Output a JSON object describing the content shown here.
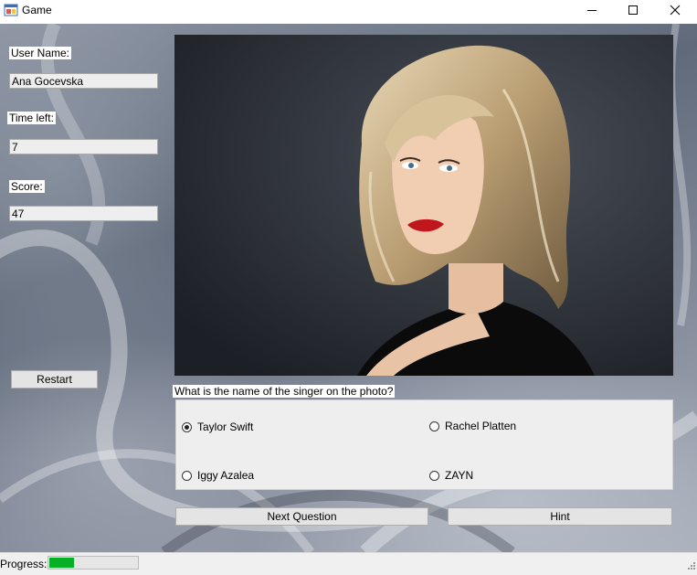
{
  "window": {
    "title": "Game"
  },
  "sidebar": {
    "username_label": "User Name:",
    "username_value": "Ana Gocevska",
    "time_label": "Time left:",
    "time_value": "7",
    "score_label": "Score:",
    "score_value": "47",
    "restart_label": "Restart"
  },
  "quiz": {
    "question": "What is the name of the singer on the photo?",
    "options": [
      {
        "label": "Taylor Swift",
        "selected": true
      },
      {
        "label": "Rachel Platten",
        "selected": false
      },
      {
        "label": "Iggy Azalea",
        "selected": false
      },
      {
        "label": "ZAYN",
        "selected": false
      }
    ],
    "next_label": "Next Question",
    "hint_label": "Hint"
  },
  "status": {
    "progress_label": "Progress:",
    "progress_fraction": 0.28,
    "progress_color": "#06b025"
  },
  "icons": {
    "app": "app-window-icon",
    "minimize": "minimize-icon",
    "maximize": "maximize-icon",
    "close": "close-icon",
    "grip": "resize-grip-icon"
  }
}
